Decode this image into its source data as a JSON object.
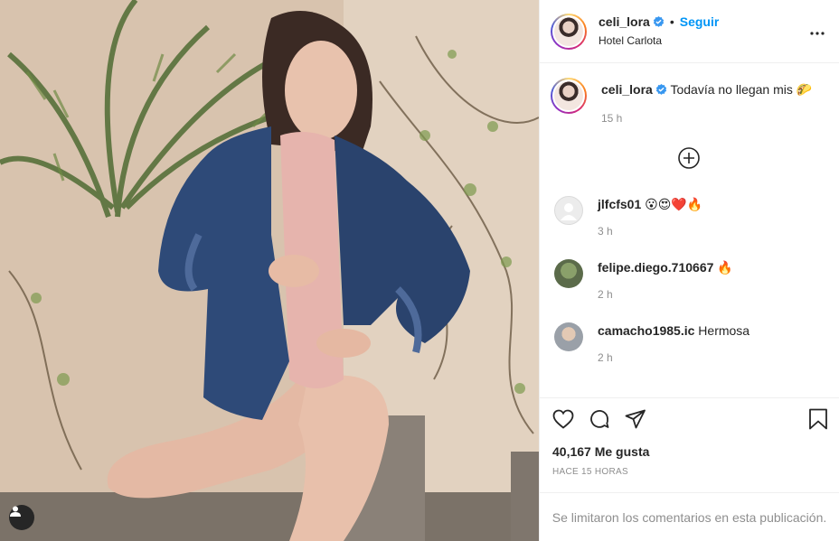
{
  "header": {
    "username": "celi_lora",
    "separator": "•",
    "follow_label": "Seguir",
    "location": "Hotel Carlota"
  },
  "caption": {
    "username": "celi_lora",
    "text": "Todavía no llegan mis 🌮",
    "time": "15 h"
  },
  "comments": [
    {
      "username": "jlfcfs01",
      "text": "😮😍❤️🔥",
      "time": "3 h"
    },
    {
      "username": "felipe.diego.710667",
      "text": "🔥",
      "time": "2 h"
    },
    {
      "username": "camacho1985.ic",
      "text": "Hermosa",
      "time": "2 h"
    }
  ],
  "likes": "40,167 Me gusta",
  "time_ago": "HACE 15 HORAS",
  "comments_limited": "Se limitaron los comentarios en esta publicación.",
  "colors": {
    "link": "#0095f6",
    "verified": "#3897f0",
    "muted": "#8e8e8e"
  },
  "icons": [
    "more-options-icon",
    "verified-badge-icon",
    "add-circle-icon",
    "heart-icon",
    "comment-icon",
    "share-icon",
    "bookmark-icon",
    "user-tag-icon"
  ]
}
